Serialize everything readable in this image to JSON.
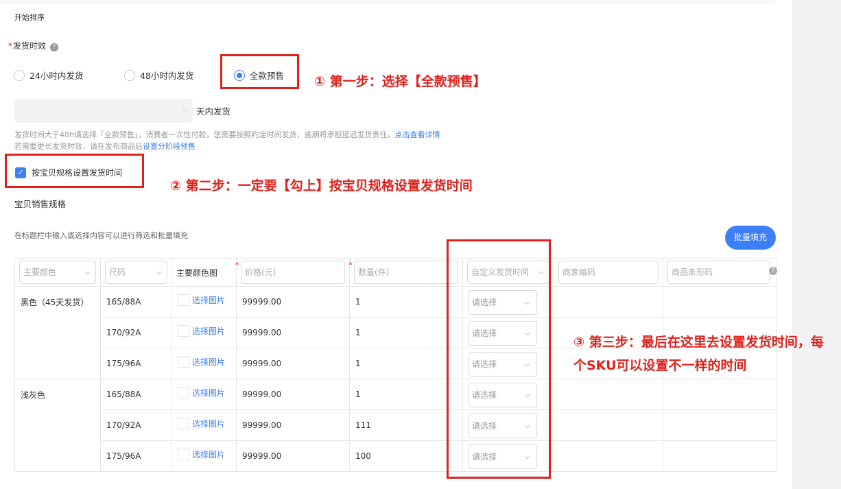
{
  "section": {
    "sort_label": "开始排序"
  },
  "shipping": {
    "required_mark": "*",
    "label": "发货时效",
    "help_icon": "question-circle-icon",
    "options": [
      {
        "label": "24小时内发货",
        "checked": false
      },
      {
        "label": "48小时内发货",
        "checked": false
      },
      {
        "label": "全款预售",
        "checked": true
      }
    ],
    "days_select": {
      "value": "",
      "suffix": "天内发货"
    },
    "hint_line1": "发货时间大于48h请选择「全款预售」，消费者一次性付款，您需要按照约定时间发货，逾期将承担延迟发货责任。",
    "hint_link1": "点击查看详情",
    "hint_line2": "若需要更长发货时效，请在发布商品后",
    "hint_link2": "设置分阶段预售"
  },
  "per_spec": {
    "checkbox_label": "按宝贝规格设置发货时间",
    "checked": true
  },
  "specs": {
    "label": "宝贝销售规格",
    "filter_hint": "在标题栏中输入或选择内容可以进行筛选和批量填充",
    "batch_button": "批量填充",
    "headers": {
      "color": "主要颜色",
      "size": "尺码",
      "color_image": "主要颜色图",
      "price": "价格(元)",
      "quantity": "数量(件)",
      "custom_time": "自定义发货时间",
      "merchant_code": "商家编码",
      "barcode": "商品条形码"
    },
    "select_image_label": "选择图片",
    "select_placeholder": "请选择",
    "groups": [
      {
        "color": "黑色（45天发货）",
        "rows": [
          {
            "size": "165/88A",
            "price": "99999.00",
            "qty": "1"
          },
          {
            "size": "170/92A",
            "price": "99999.00",
            "qty": "1"
          },
          {
            "size": "175/96A",
            "price": "99999.00",
            "qty": "1"
          }
        ]
      },
      {
        "color": "浅灰色",
        "rows": [
          {
            "size": "165/88A",
            "price": "99999.00",
            "qty": "1"
          },
          {
            "size": "170/92A",
            "price": "99999.00",
            "qty": "111"
          },
          {
            "size": "175/96A",
            "price": "99999.00",
            "qty": "100"
          }
        ]
      }
    ]
  },
  "annotations": {
    "step1": "① 第一步：选择【全款预售】",
    "step2": "② 第二步：一定要【勾上】按宝贝规格设置发货时间",
    "step3": "③ 第三步：最后在这里去设置发货时间，每个SKU可以设置不一样的时间"
  },
  "colors": {
    "accent": "#3d7ff6",
    "annotation_red": "#e0201b"
  }
}
